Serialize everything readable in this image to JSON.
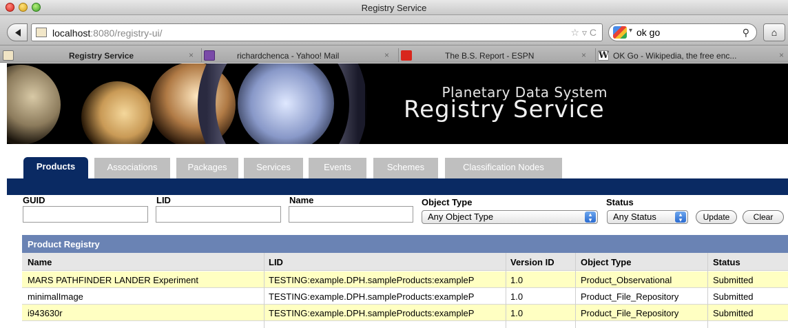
{
  "window": {
    "title": "Registry Service"
  },
  "toolbar": {
    "url_host": "localhost",
    "url_rest": ":8080/registry-ui/",
    "search_value": "ok go"
  },
  "browser_tabs": [
    {
      "label": "Registry Service"
    },
    {
      "label": "richardchenca - Yahoo! Mail"
    },
    {
      "label": "The B.S. Report - ESPN"
    },
    {
      "label": "OK Go - Wikipedia, the free enc..."
    }
  ],
  "banner": {
    "line1": "Planetary Data System",
    "line2": "Registry Service"
  },
  "nav_tabs": [
    {
      "label": "Products"
    },
    {
      "label": "Associations"
    },
    {
      "label": "Packages"
    },
    {
      "label": "Services"
    },
    {
      "label": "Events"
    },
    {
      "label": "Schemes"
    },
    {
      "label": "Classification Nodes"
    }
  ],
  "filters": {
    "guid_label": "GUID",
    "lid_label": "LID",
    "name_label": "Name",
    "object_type_label": "Object Type",
    "object_type_value": "Any Object Type",
    "status_label": "Status",
    "status_value": "Any Status",
    "update_label": "Update",
    "clear_label": "Clear"
  },
  "panel": {
    "title": "Product Registry"
  },
  "table": {
    "columns": [
      "Name",
      "LID",
      "Version ID",
      "Object Type",
      "Status"
    ],
    "rows": [
      [
        "MARS PATHFINDER LANDER Experiment",
        "TESTING:example.DPH.sampleProducts:exampleP",
        "1.0",
        "Product_Observational",
        "Submitted"
      ],
      [
        "minimalImage",
        "TESTING:example.DPH.sampleProducts:exampleP",
        "1.0",
        "Product_File_Repository",
        "Submitted"
      ],
      [
        "i943630r",
        "TESTING:example.DPH.sampleProducts:exampleP",
        "1.0",
        "Product_File_Repository",
        "Submitted"
      ]
    ]
  },
  "colors": {
    "nav_band": "#0a2a63",
    "panel_header": "#6a83b4",
    "row_highlight": "#ffffc2"
  }
}
